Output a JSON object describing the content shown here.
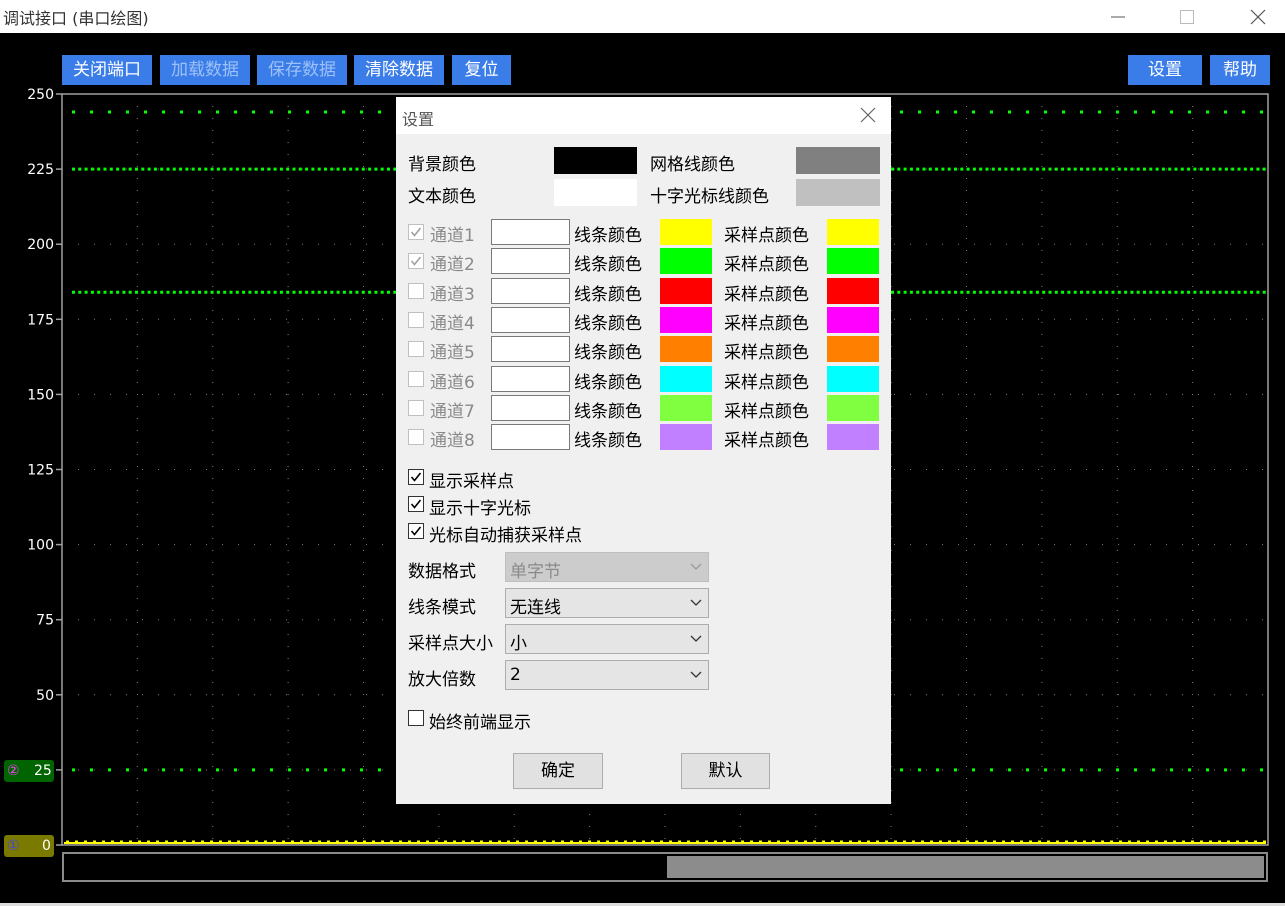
{
  "window": {
    "title": "调试接口 (串口绘图)"
  },
  "toolbar": {
    "close_port": "关闭端口",
    "load_data": "加载数据",
    "save_data": "保存数据",
    "clear_data": "清除数据",
    "reset": "复位",
    "settings": "设置",
    "help": "帮助"
  },
  "plot": {
    "y_ticks": [
      "250",
      "225",
      "200",
      "175",
      "150",
      "125",
      "100",
      "75",
      "50",
      "25",
      "0"
    ],
    "ylim": [
      0,
      250
    ],
    "grid": true,
    "colors": {
      "background": "#000000",
      "grid": "#808080",
      "axis": "#a0a0a0"
    },
    "series": [
      {
        "channel": "1",
        "color": "#ffff00",
        "level": 0
      },
      {
        "channel": "2",
        "color": "#00ff00",
        "levels": [
          25,
          184,
          225,
          244
        ]
      }
    ],
    "badges": [
      {
        "icon": "①",
        "value": "0",
        "color": "#7a7a00"
      },
      {
        "icon": "②",
        "value": "25",
        "color": "#006400"
      }
    ],
    "scroll_position": 0.5
  },
  "dialog": {
    "title": "设置",
    "background_color_label": "背景颜色",
    "grid_color_label": "网格线颜色",
    "text_color_label": "文本颜色",
    "crosshair_color_label": "十字光标线颜色",
    "colors": {
      "background": "#000000",
      "grid": "#808080",
      "text": "#ffffff",
      "crosshair": "#c0c0c0"
    },
    "line_color_label": "线条颜色",
    "sample_color_label": "采样点颜色",
    "channels": [
      {
        "name": "通道1",
        "checked": true,
        "line": "#ffff00",
        "point": "#ffff00"
      },
      {
        "name": "通道2",
        "checked": true,
        "line": "#00ff00",
        "point": "#00ff00"
      },
      {
        "name": "通道3",
        "checked": false,
        "line": "#ff0000",
        "point": "#ff0000"
      },
      {
        "name": "通道4",
        "checked": false,
        "line": "#ff00ff",
        "point": "#ff00ff"
      },
      {
        "name": "通道5",
        "checked": false,
        "line": "#ff8000",
        "point": "#ff8000"
      },
      {
        "name": "通道6",
        "checked": false,
        "line": "#00ffff",
        "point": "#00ffff"
      },
      {
        "name": "通道7",
        "checked": false,
        "line": "#80ff40",
        "point": "#80ff40"
      },
      {
        "name": "通道8",
        "checked": false,
        "line": "#c080ff",
        "point": "#c080ff"
      }
    ],
    "options": [
      {
        "label": "显示采样点",
        "checked": true
      },
      {
        "label": "显示十字光标",
        "checked": true
      },
      {
        "label": "光标自动捕获采样点",
        "checked": true
      }
    ],
    "selects": [
      {
        "label": "数据格式",
        "value": "单字节",
        "disabled": true
      },
      {
        "label": "线条模式",
        "value": "无连线",
        "disabled": false
      },
      {
        "label": "采样点大小",
        "value": "小",
        "disabled": false
      },
      {
        "label": "放大倍数",
        "value": "2",
        "disabled": false
      }
    ],
    "always_on_top": {
      "label": "始终前端显示",
      "checked": false
    },
    "ok": "确定",
    "default": "默认"
  }
}
